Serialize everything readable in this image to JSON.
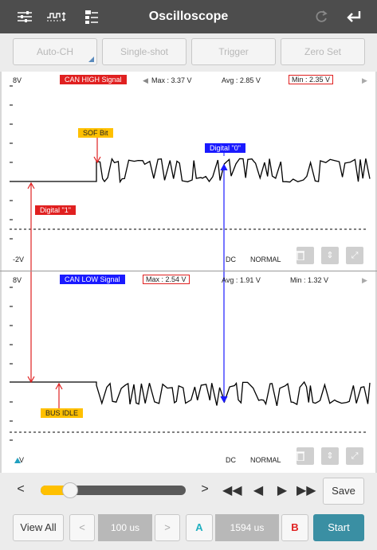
{
  "app": {
    "title": "Oscilloscope"
  },
  "toolbar": {
    "buttons": [
      "Auto-CH",
      "Single-shot",
      "Trigger",
      "Zero Set"
    ]
  },
  "channel1": {
    "top_voltage": "8V",
    "bottom_voltage": "-2V",
    "signal_label": "CAN HIGH Signal",
    "max": "Max : 3.37 V",
    "avg": "Avg : 2.85 V",
    "min": "Min : 2.35 V",
    "coupling": "DC",
    "mode": "NORMAL",
    "color": "#e02020"
  },
  "channel2": {
    "top_voltage": "8V",
    "bottom_voltage": "V",
    "signal_label": "CAN LOW Signal",
    "max": "Max : 2.54 V",
    "avg": "Avg : 1.91 V",
    "min": "Min : 1.32 V",
    "coupling": "DC",
    "mode": "NORMAL",
    "color": "#1a1aff"
  },
  "annotations": {
    "sof": "SOF Bit",
    "digital0": "Digital \"0\"",
    "digital1": "Digital \"1\"",
    "bus_idle": "BUS IDLE"
  },
  "controls": {
    "save": "Save",
    "view_all": "View All",
    "timebase": "100 us",
    "cursor_a": "A",
    "cursor_delta": "1594 us",
    "cursor_b": "B",
    "start": "Start",
    "slider_value": 0.15
  },
  "icons": [
    "settings-sliders-icon",
    "waveform-icon",
    "channel-config-icon",
    "refresh-icon",
    "back-arrow-icon",
    "trash-icon",
    "vertical-arrows-icon",
    "expand-icon",
    "chevron-left-icon",
    "chevron-right-icon",
    "fast-rewind-icon",
    "play-back-icon",
    "play-forward-icon",
    "fast-forward-icon"
  ]
}
